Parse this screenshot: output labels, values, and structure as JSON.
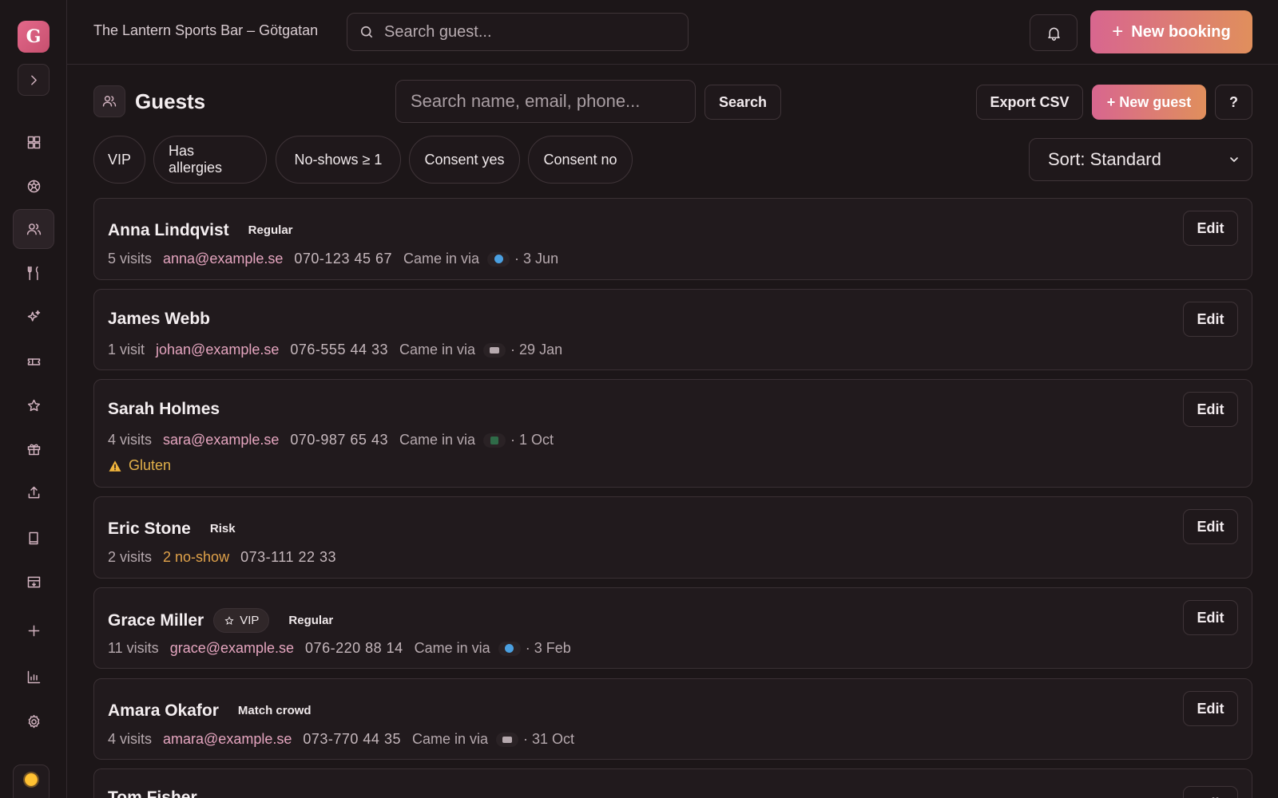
{
  "app": {
    "logo_letter": "G",
    "venue_name": "The Lantern Sports Bar – Götgatan",
    "top_search_placeholder": "Search guest...",
    "new_booking_label": "New booking"
  },
  "sidebar": {
    "items": [
      {
        "icon": "dashboard-icon",
        "active": false
      },
      {
        "icon": "football-icon",
        "active": false
      },
      {
        "icon": "users-icon",
        "active": true
      },
      {
        "icon": "utensils-icon",
        "active": false
      },
      {
        "icon": "sparkles-icon",
        "active": false
      },
      {
        "icon": "ticket-icon",
        "active": false
      },
      {
        "icon": "star-icon",
        "active": false
      },
      {
        "icon": "gift-icon",
        "active": false
      },
      {
        "icon": "upload-icon",
        "active": false
      },
      {
        "icon": "book-icon",
        "active": false
      },
      {
        "icon": "archive-icon",
        "active": false
      },
      {
        "icon": "plus-icon",
        "active": false
      },
      {
        "icon": "bar-chart-icon",
        "active": false
      },
      {
        "icon": "settings-icon",
        "active": false
      }
    ]
  },
  "page": {
    "title": "Guests",
    "search_placeholder": "Search name, email, phone...",
    "search_button": "Search",
    "export_button": "Export CSV",
    "new_guest_button": "+ New guest",
    "help_button": "?"
  },
  "filters": [
    "VIP",
    "Has allergies",
    "No-shows ≥ 1",
    "Consent yes",
    "Consent no"
  ],
  "sort": {
    "selected": "Sort: Standard"
  },
  "guests": [
    {
      "name": "Anna Lindqvist",
      "tags": [
        "Regular"
      ],
      "visits": "5 visits",
      "email": "anna@example.se",
      "phone": "070-123 45 67",
      "came_in_via": "Came in via",
      "source": "web",
      "date": "· 3 Jun",
      "edit": "Edit"
    },
    {
      "name": "James Webb",
      "tags": [],
      "visits": "1 visit",
      "email": "johan@example.se",
      "phone": "076-555 44 33",
      "came_in_via": "Came in via",
      "source": "card",
      "date": "· 29 Jan",
      "edit": "Edit"
    },
    {
      "name": "Sarah Holmes",
      "tags": [],
      "visits": "4 visits",
      "email": "sara@example.se",
      "phone": "070-987 65 43",
      "came_in_via": "Came in via",
      "source": "green",
      "date": "· 1 Oct",
      "allergy": "Gluten",
      "edit": "Edit"
    },
    {
      "name": "Eric Stone",
      "tags": [
        "Risk"
      ],
      "visits": "2 visits",
      "noshow": "2 no-show",
      "phone": "073-111 22 33",
      "edit": "Edit"
    },
    {
      "name": "Grace Miller",
      "vip_label": "VIP",
      "tags": [
        "Regular"
      ],
      "visits": "11 visits",
      "email": "grace@example.se",
      "phone": "076-220 88 14",
      "came_in_via": "Came in via",
      "source": "web",
      "date": "· 3 Feb",
      "edit": "Edit"
    },
    {
      "name": "Amara Okafor",
      "tags": [
        "Match crowd"
      ],
      "visits": "4 visits",
      "email": "amara@example.se",
      "phone": "073-770 44 35",
      "came_in_via": "Came in via",
      "source": "card",
      "date": "· 31 Oct",
      "edit": "Edit"
    },
    {
      "name": "Tom Fisher",
      "edit": "Edit"
    }
  ]
}
